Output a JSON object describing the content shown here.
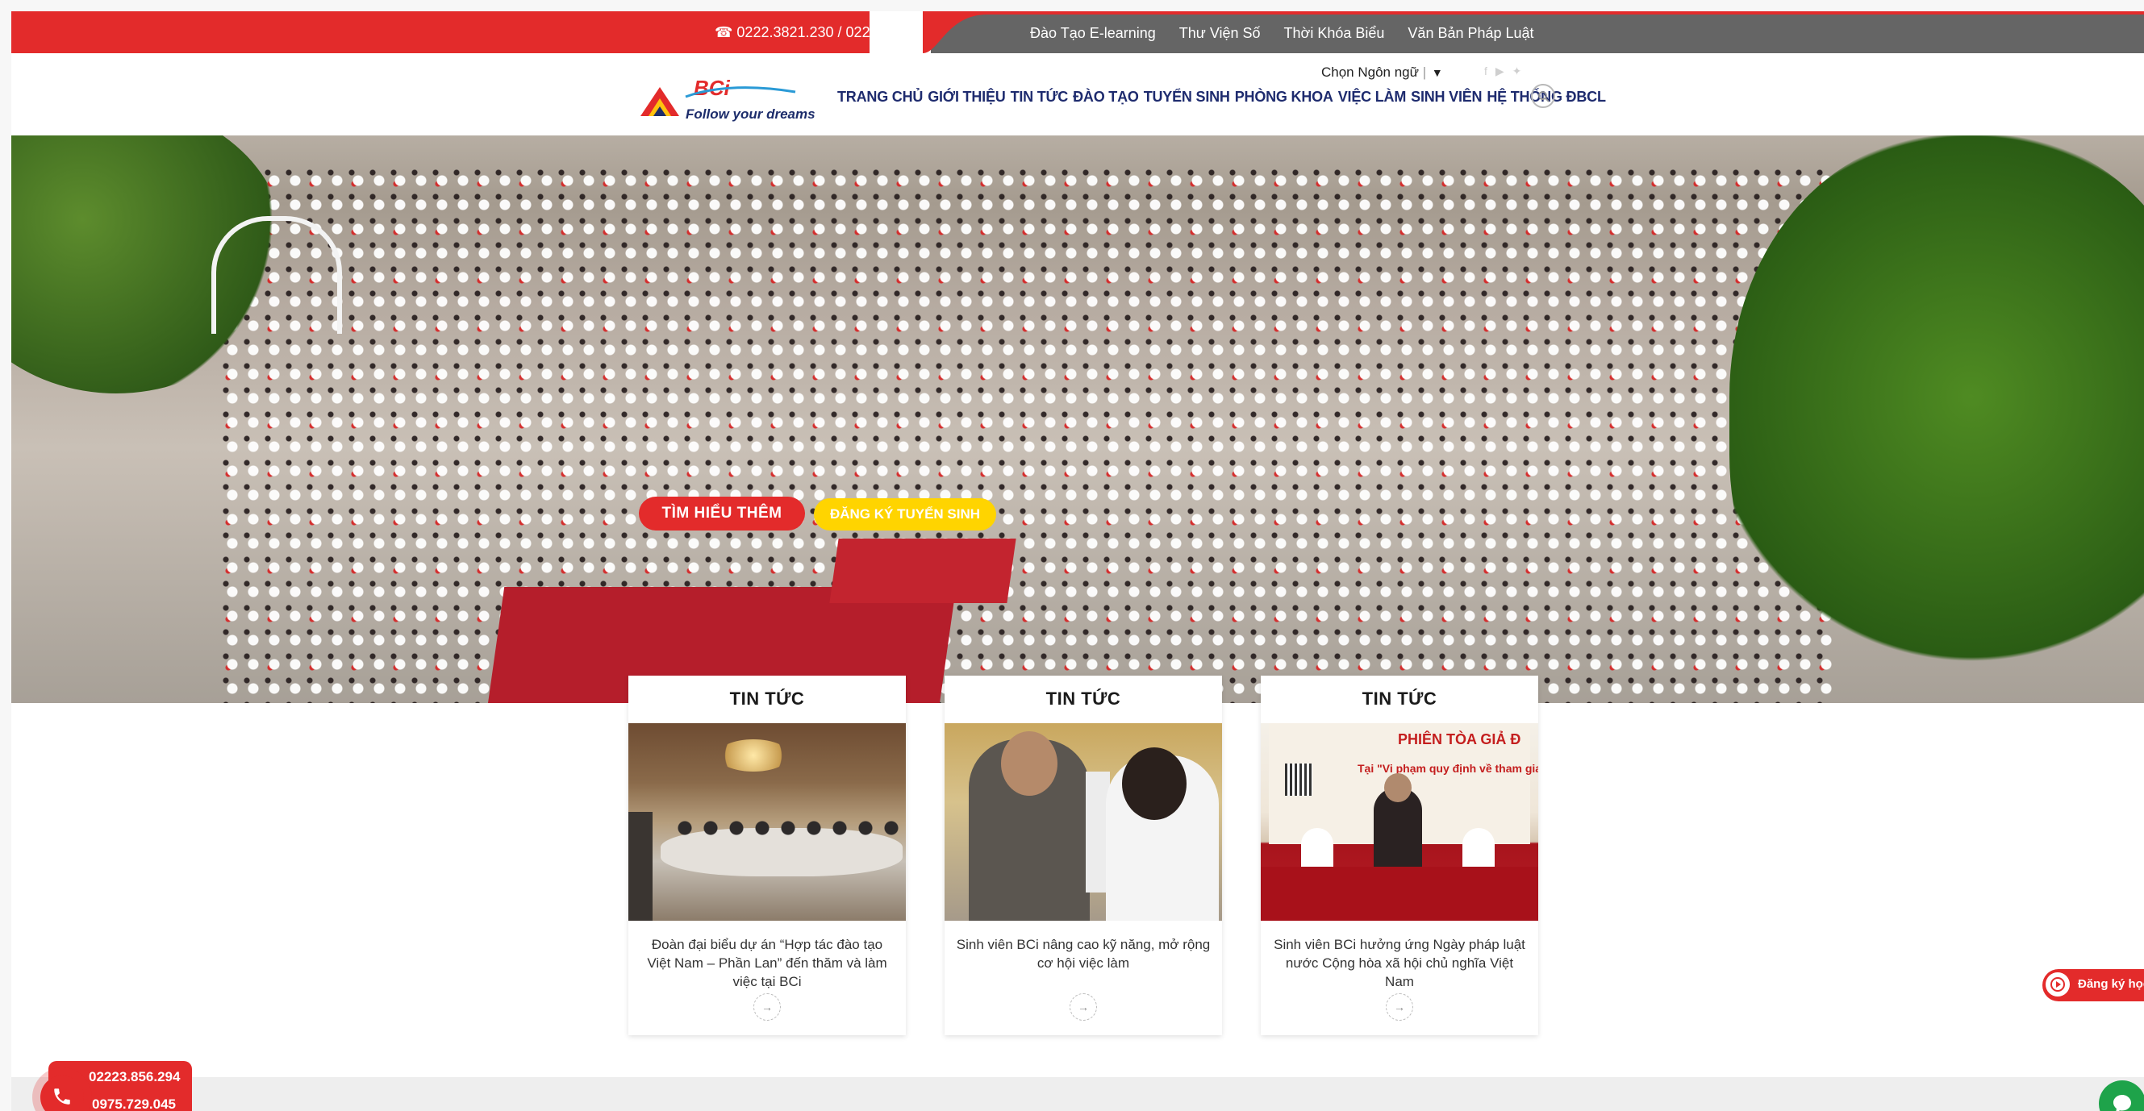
{
  "topbar": {
    "phone": "☎ 0222.3821.230 / 0222",
    "links": [
      "Đào Tạo E-learning",
      "Thư Viện Số",
      "Thời Khóa Biểu",
      "Văn Bản Pháp Luật"
    ]
  },
  "header": {
    "logo_name": "BCi",
    "logo_slogan": "Follow your dreams",
    "language_label": "Chọn Ngôn ngữ",
    "nav": [
      "TRANG CHỦ",
      "GIỚI THIỆU",
      "TIN TỨC",
      "ĐÀO TẠO",
      "TUYỂN SINH",
      "PHÒNG KHOA",
      "VIỆC LÀM",
      "SINH VIÊN",
      "HỆ THỐNG ĐBCL"
    ]
  },
  "hero": {
    "learn_more": "TÌM HIỂU THÊM",
    "register": "ĐĂNG KÝ TUYỂN SINH"
  },
  "news": [
    {
      "title": "TIN TỨC",
      "text": "Đoàn đại biểu dự án “Hợp tác đào tạo Việt Nam – Phần Lan” đến thăm và làm việc tại BCi"
    },
    {
      "title": "TIN TỨC",
      "text": "Sinh viên BCi nâng cao kỹ năng, mở rộng cơ hội việc làm"
    },
    {
      "title": "TIN TỨC",
      "text": "Sinh viên BCi hưởng ứng Ngày pháp luật nước Cộng hòa xã hội chủ nghĩa Việt Nam"
    }
  ],
  "trial_image": {
    "title": "PHIÊN TÒA GIẢ Đ",
    "subtitle": "Tại \"Vi phạm quy định về tham gia gi"
  },
  "widgets": {
    "phone1": "02223.856.294",
    "phone2": "0975.729.045",
    "register": "Đăng ký học"
  },
  "colors": {
    "brand_red": "#e32b2b",
    "navy": "#1e2b6e",
    "yellow": "#ffd400",
    "chat_green": "#1ea34a"
  }
}
